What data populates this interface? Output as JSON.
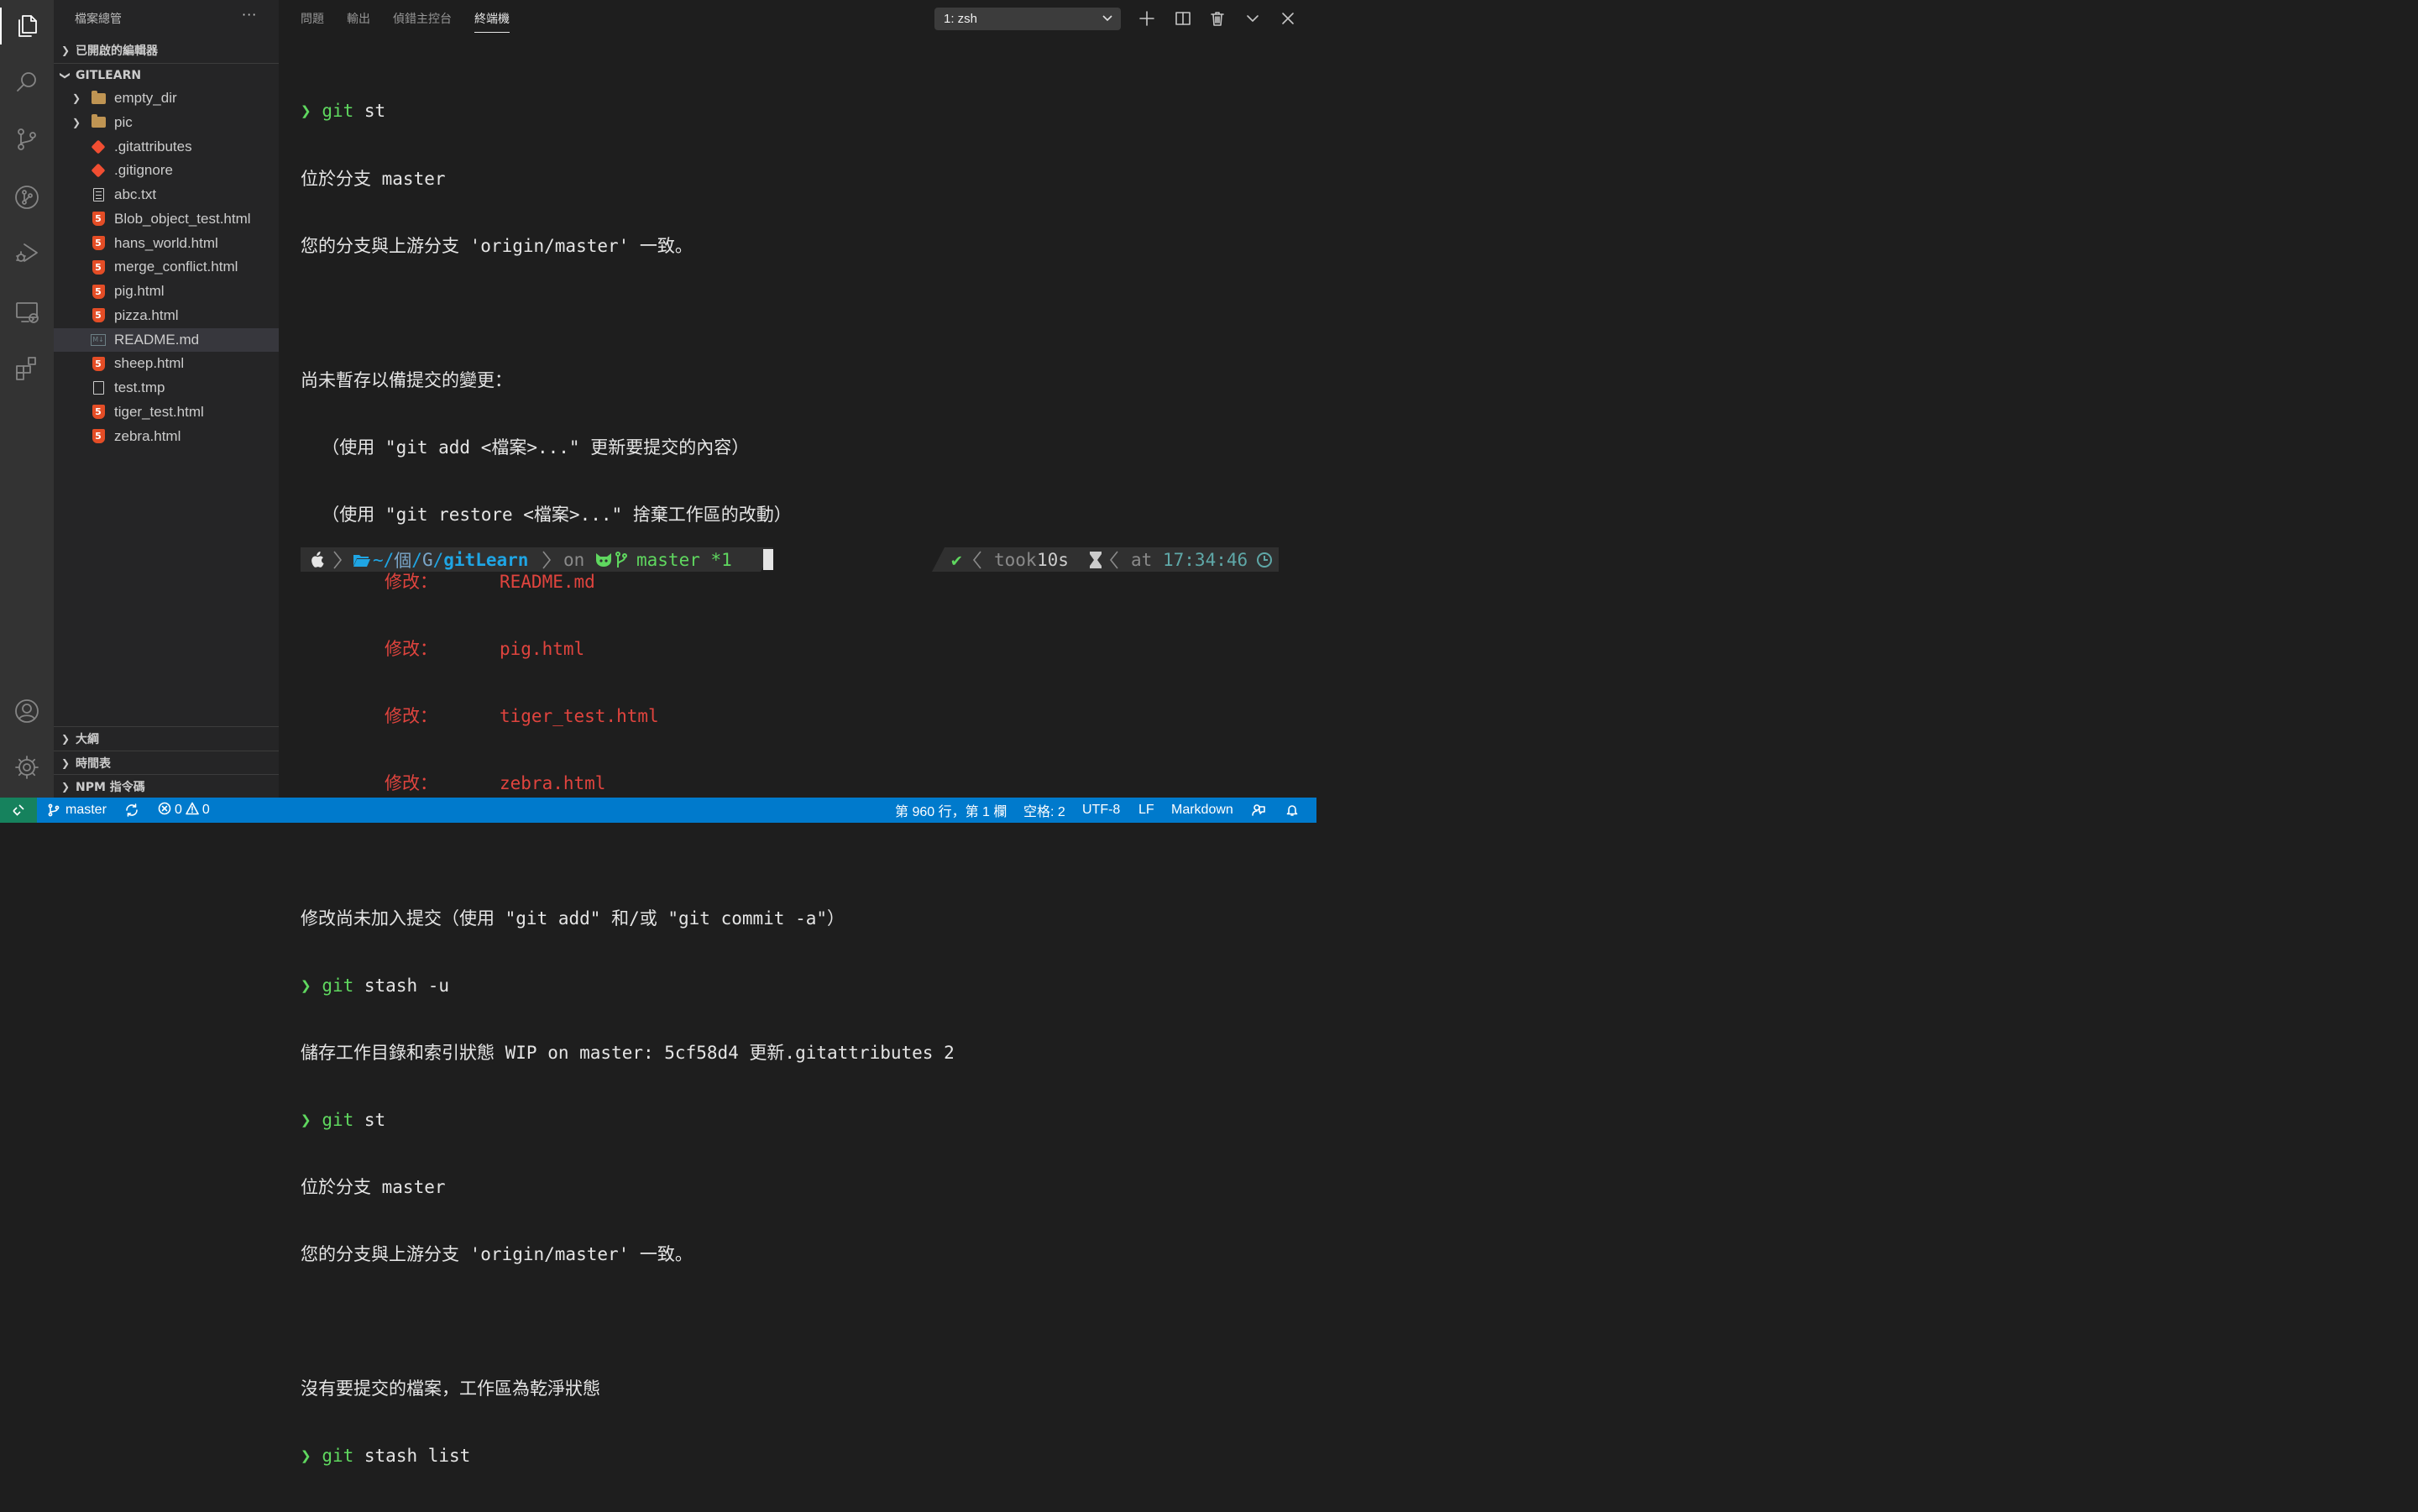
{
  "sidebar": {
    "title": "檔案總管",
    "more": "···",
    "open_editors": "已開啟的編輯器",
    "project": "GITLEARN",
    "files": [
      {
        "name": "empty_dir",
        "icon": "folder-icon"
      },
      {
        "name": "pic",
        "icon": "folder-icon"
      },
      {
        "name": ".gitattributes",
        "icon": "git-icon"
      },
      {
        "name": ".gitignore",
        "icon": "git-icon"
      },
      {
        "name": "abc.txt",
        "icon": "text-file-icon"
      },
      {
        "name": "Blob_object_test.html",
        "icon": "html5-icon"
      },
      {
        "name": "hans_world.html",
        "icon": "html5-icon"
      },
      {
        "name": "merge_conflict.html",
        "icon": "html5-icon"
      },
      {
        "name": "pig.html",
        "icon": "html5-icon"
      },
      {
        "name": "pizza.html",
        "icon": "html5-icon"
      },
      {
        "name": "README.md",
        "icon": "markdown-icon"
      },
      {
        "name": "sheep.html",
        "icon": "html5-icon"
      },
      {
        "name": "test.tmp",
        "icon": "file-icon"
      },
      {
        "name": "tiger_test.html",
        "icon": "html5-icon"
      },
      {
        "name": "zebra.html",
        "icon": "html5-icon"
      }
    ],
    "selected_file": "README.md",
    "outline": "大綱",
    "timeline": "時間表",
    "npm": "NPM 指令碼"
  },
  "panel": {
    "tabs": [
      "問題",
      "輸出",
      "偵錯主控台",
      "終端機"
    ],
    "active_tab": "終端機",
    "terminal_select": "1: zsh"
  },
  "terminal": {
    "prompt_symbol": "❯",
    "lines": {
      "l1_cmd": "git",
      "l1_arg": " st",
      "l2": "位於分支 master",
      "l3": "您的分支與上游分支 'origin/master' 一致。",
      "l4": "",
      "l5": "尚未暫存以備提交的變更：",
      "l6": "  （使用 \"git add <檔案>...\" 更新要提交的內容）",
      "l7": "  （使用 \"git restore <檔案>...\" 捨棄工作區的改動）",
      "m_label": "修改：",
      "m1": "README.md",
      "m2": "pig.html",
      "m3": "tiger_test.html",
      "m4": "zebra.html",
      "l12": "",
      "l13": "修改尚未加入提交（使用 \"git add\" 和/或 \"git commit -a\"）",
      "l14_cmd": "git",
      "l14_arg": " stash -u",
      "l15": "儲存工作目錄和索引狀態 WIP on master: 5cf58d4 更新.gitattributes 2",
      "l16_cmd": "git",
      "l16_arg": " st",
      "l17": "位於分支 master",
      "l18": "您的分支與上游分支 'origin/master' 一致。",
      "l19": "",
      "l20": "沒有要提交的檔案，工作區為乾淨狀態",
      "l21_cmd": "git",
      "l21_arg": " stash list"
    },
    "prompt": {
      "path_prefix": "~/",
      "path_mid1": "個",
      "path_sep1": "/",
      "path_mid2": "G",
      "path_sep2": "/",
      "path_dir": "gitLearn",
      "on": "on",
      "branch": "master *1",
      "check": "✔",
      "took": "took",
      "duration": "10s",
      "at": "at",
      "time": "17:34:46"
    }
  },
  "status": {
    "branch": "master",
    "errors": "0",
    "warnings": "0",
    "position": "第 960 行，第 1 欄",
    "spaces": "空格: 2",
    "encoding": "UTF-8",
    "eol": "LF",
    "language": "Markdown"
  },
  "colors": {
    "activity_bar": "#333333",
    "sidebar": "#252526",
    "editor": "#1e1e1e",
    "status_bar": "#007acc",
    "remote": "#16825d",
    "prompt_green": "#5fd75f",
    "modified_red": "#e0443e",
    "prompt_bg": "#303030",
    "path_blue": "#1fa5e4"
  }
}
